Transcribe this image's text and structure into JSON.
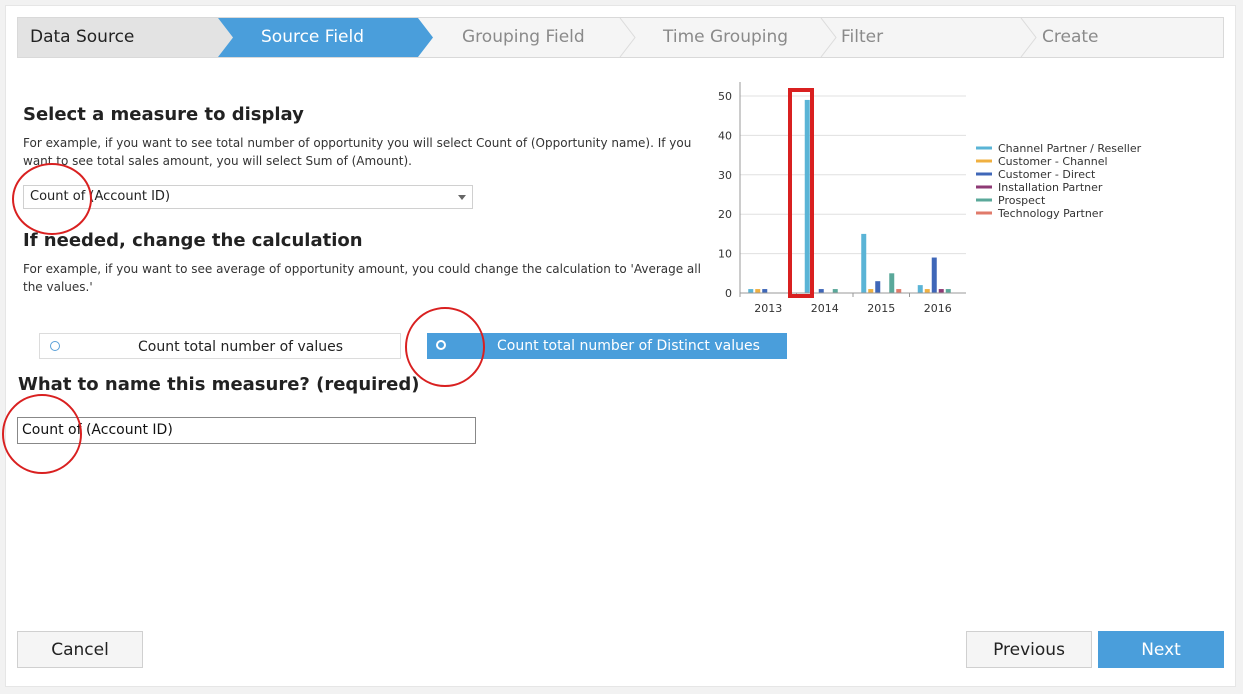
{
  "wizard": {
    "steps": [
      "Data Source",
      "Source Field",
      "Grouping Field",
      "Time Grouping",
      "Filter",
      "Create"
    ],
    "active_index": 1
  },
  "measure": {
    "title": "Select a measure to display",
    "description": "For example, if you want to see total number of opportunity you will select Count of (Opportunity name). If you want to see total sales amount, you will select Sum of (Amount).",
    "selected": "Count of (Account ID)"
  },
  "calculation": {
    "title": "If needed, change the calculation",
    "description": "For example, if you want to see average of opportunity amount, you could change the calculation to 'Average all the values.'",
    "options": [
      "Count total number of values",
      "Count total number of Distinct values"
    ],
    "selected_index": 1
  },
  "name": {
    "title": "What to name this measure? (required)",
    "value": "Count of (Account ID)"
  },
  "footer": {
    "cancel": "Cancel",
    "previous": "Previous",
    "next": "Next"
  },
  "colors": {
    "accent": "#4a9edb",
    "annotation": "#d92020"
  },
  "chart_data": {
    "type": "bar",
    "categories": [
      "2013",
      "2014",
      "2015",
      "2016"
    ],
    "ylim": [
      0,
      50
    ],
    "yticks": [
      0,
      10,
      20,
      30,
      40,
      50
    ],
    "legend_position": "right",
    "grid": true,
    "series": [
      {
        "name": "Channel Partner / Reseller",
        "color": "#5ab4d6",
        "values": [
          1,
          49,
          15,
          2
        ]
      },
      {
        "name": "Customer - Channel",
        "color": "#f0b040",
        "values": [
          1,
          0,
          1,
          1
        ]
      },
      {
        "name": "Customer - Direct",
        "color": "#3f67b8",
        "values": [
          1,
          1,
          3,
          9
        ]
      },
      {
        "name": "Installation Partner",
        "color": "#8e3a75",
        "values": [
          0,
          0,
          0,
          1
        ]
      },
      {
        "name": "Prospect",
        "color": "#5aa89a",
        "values": [
          0,
          1,
          5,
          1
        ]
      },
      {
        "name": "Technology Partner",
        "color": "#e07a6a",
        "values": [
          0,
          0,
          1,
          0
        ]
      }
    ]
  }
}
